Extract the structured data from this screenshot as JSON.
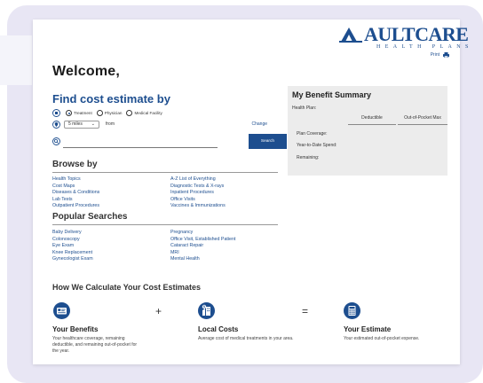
{
  "brand": {
    "name": "AULTCARE",
    "sub": "HEALTH PLANS",
    "accent": "#1d4e8f"
  },
  "header": {
    "print_label": "Print",
    "print_icon": "printer-icon"
  },
  "welcome": "Welcome,",
  "find": {
    "title": "Find cost estimate by",
    "types": [
      "Treatment",
      "Physician",
      "Medical Facility"
    ],
    "selected_type": "Treatment",
    "distance": "5 miles",
    "from_label": "from",
    "change_label": "Change",
    "search_placeholder": "",
    "search_button": "Search"
  },
  "benefit": {
    "title": "My Benefit Summary",
    "health_plan_label": "Health Plan:",
    "col_deductible": "Deductible",
    "col_oop": "Out-of-Pocket Max",
    "rows": [
      "Plan Coverage:",
      "Year-to-Date Spend:",
      "Remaining:"
    ]
  },
  "browse": {
    "title": "Browse by",
    "left": [
      "Health Topics",
      "Cost Maps",
      "Diseases & Conditions",
      "Lab Tests",
      "Outpatient Procedures"
    ],
    "right": [
      "A-Z List of Everything",
      "Diagnostic Tests & X-rays",
      "Inpatient Procedures",
      "Office Visits",
      "Vaccines & Immunizations"
    ]
  },
  "popular": {
    "title": "Popular Searches",
    "left": [
      "Baby Delivery",
      "Colonoscopy",
      "Eye Exam",
      "Knee Replacement",
      "Gynecologist Exam"
    ],
    "right": [
      "Pregnancy",
      "Office Visit, Established Patient",
      "Cataract Repair",
      "MRI",
      "Mental Health"
    ]
  },
  "calc": {
    "title": "How We Calculate Your Cost Estimates",
    "plus": "+",
    "equals": "=",
    "items": [
      {
        "icon": "benefits-card-icon",
        "head": "Your Benefits",
        "desc": "Your healthcare coverage, remaining deductible, and remaining out-of-pocket for the year."
      },
      {
        "icon": "local-costs-icon",
        "head": "Local Costs",
        "desc": "Average cost of medical treatments in your area."
      },
      {
        "icon": "calculator-icon",
        "head": "Your Estimate",
        "desc": "Your estimated out-of-pocket expense."
      }
    ]
  }
}
